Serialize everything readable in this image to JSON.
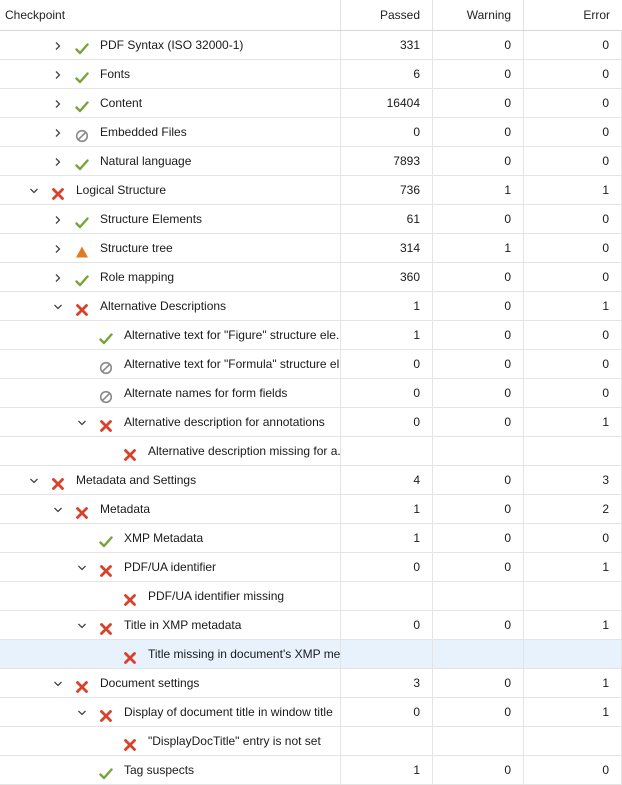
{
  "columns": {
    "checkpoint": "Checkpoint",
    "passed": "Passed",
    "warning": "Warning",
    "error": "Error"
  },
  "rows": [
    {
      "level": 2,
      "expander": "collapsed",
      "status": "pass",
      "label": "PDF Syntax (ISO 32000-1)",
      "passed": "331",
      "warning": "0",
      "error": "0"
    },
    {
      "level": 2,
      "expander": "collapsed",
      "status": "pass",
      "label": "Fonts",
      "passed": "6",
      "warning": "0",
      "error": "0"
    },
    {
      "level": 2,
      "expander": "collapsed",
      "status": "pass",
      "label": "Content",
      "passed": "16404",
      "warning": "0",
      "error": "0"
    },
    {
      "level": 2,
      "expander": "collapsed",
      "status": "skip",
      "label": "Embedded Files",
      "passed": "0",
      "warning": "0",
      "error": "0"
    },
    {
      "level": 2,
      "expander": "collapsed",
      "status": "pass",
      "label": "Natural language",
      "passed": "7893",
      "warning": "0",
      "error": "0"
    },
    {
      "level": 1,
      "expander": "expanded",
      "status": "fail",
      "label": "Logical Structure",
      "passed": "736",
      "warning": "1",
      "error": "1"
    },
    {
      "level": 2,
      "expander": "collapsed",
      "status": "pass",
      "label": "Structure Elements",
      "passed": "61",
      "warning": "0",
      "error": "0"
    },
    {
      "level": 2,
      "expander": "collapsed",
      "status": "warn",
      "label": "Structure tree",
      "passed": "314",
      "warning": "1",
      "error": "0"
    },
    {
      "level": 2,
      "expander": "collapsed",
      "status": "pass",
      "label": "Role mapping",
      "passed": "360",
      "warning": "0",
      "error": "0"
    },
    {
      "level": 2,
      "expander": "expanded",
      "status": "fail",
      "label": "Alternative Descriptions",
      "passed": "1",
      "warning": "0",
      "error": "1"
    },
    {
      "level": 3,
      "expander": "none",
      "status": "pass",
      "label": "Alternative text for \"Figure\" structure ele...",
      "passed": "1",
      "warning": "0",
      "error": "0"
    },
    {
      "level": 3,
      "expander": "none",
      "status": "skip",
      "label": "Alternative text for \"Formula\" structure el...",
      "passed": "0",
      "warning": "0",
      "error": "0"
    },
    {
      "level": 3,
      "expander": "none",
      "status": "skip",
      "label": "Alternate names for form fields",
      "passed": "0",
      "warning": "0",
      "error": "0"
    },
    {
      "level": 3,
      "expander": "expanded",
      "status": "fail",
      "label": "Alternative description for annotations",
      "passed": "0",
      "warning": "0",
      "error": "1"
    },
    {
      "level": 4,
      "expander": "none",
      "status": "fail",
      "label": "Alternative description missing for a...",
      "passed": "",
      "warning": "",
      "error": ""
    },
    {
      "level": 1,
      "expander": "expanded",
      "status": "fail",
      "label": "Metadata and Settings",
      "passed": "4",
      "warning": "0",
      "error": "3"
    },
    {
      "level": 2,
      "expander": "expanded",
      "status": "fail",
      "label": "Metadata",
      "passed": "1",
      "warning": "0",
      "error": "2"
    },
    {
      "level": 3,
      "expander": "none",
      "status": "pass",
      "label": "XMP Metadata",
      "passed": "1",
      "warning": "0",
      "error": "0"
    },
    {
      "level": 3,
      "expander": "expanded",
      "status": "fail",
      "label": "PDF/UA identifier",
      "passed": "0",
      "warning": "0",
      "error": "1"
    },
    {
      "level": 4,
      "expander": "none",
      "status": "fail",
      "label": "PDF/UA identifier missing",
      "passed": "",
      "warning": "",
      "error": ""
    },
    {
      "level": 3,
      "expander": "expanded",
      "status": "fail",
      "label": "Title in XMP metadata",
      "passed": "0",
      "warning": "0",
      "error": "1"
    },
    {
      "level": 4,
      "expander": "none",
      "status": "fail",
      "label": "Title missing in document's XMP meta...",
      "passed": "",
      "warning": "",
      "error": "",
      "selected": true
    },
    {
      "level": 2,
      "expander": "expanded",
      "status": "fail",
      "label": "Document settings",
      "passed": "3",
      "warning": "0",
      "error": "1"
    },
    {
      "level": 3,
      "expander": "expanded",
      "status": "fail",
      "label": "Display of document title in window title",
      "passed": "0",
      "warning": "0",
      "error": "1"
    },
    {
      "level": 4,
      "expander": "none",
      "status": "fail",
      "label": "\"DisplayDocTitle\" entry is not set",
      "passed": "",
      "warning": "",
      "error": ""
    },
    {
      "level": 3,
      "expander": "none",
      "status": "pass",
      "label": "Tag suspects",
      "passed": "1",
      "warning": "0",
      "error": "0"
    }
  ],
  "colors": {
    "pass": "#7aa33a",
    "fail": "#d9412b",
    "warn": "#e07b22",
    "skip": "#8a8a8a",
    "selected_row": "#e8f2fd"
  }
}
